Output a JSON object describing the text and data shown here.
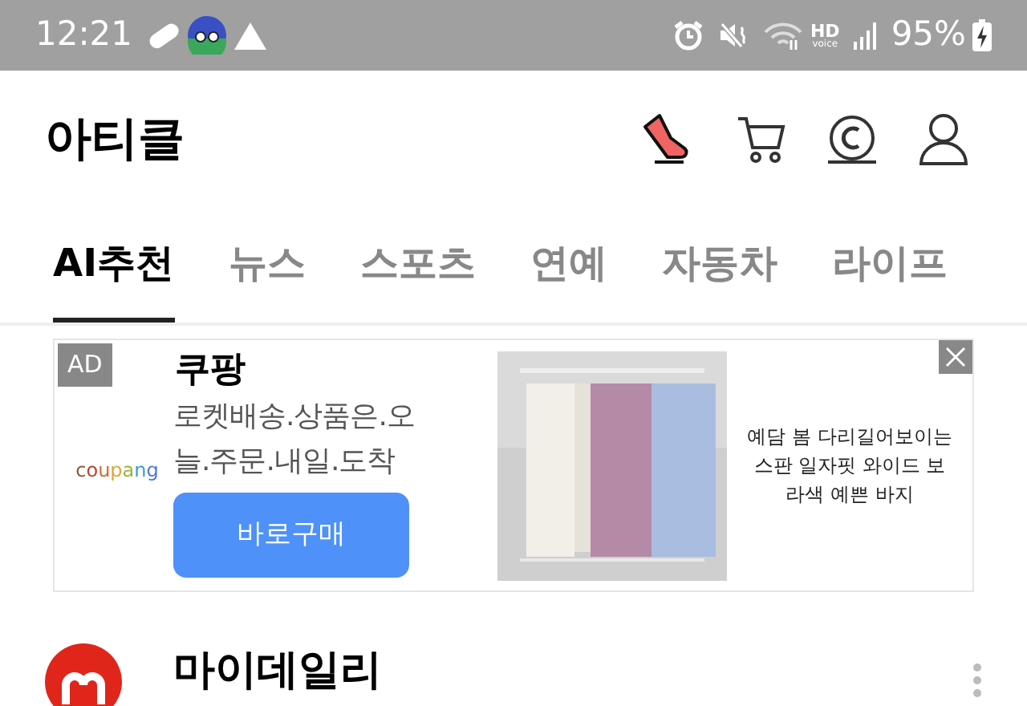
{
  "status_bar": {
    "time": "12:21",
    "hd": "HD",
    "voice": "voice",
    "battery": "95%"
  },
  "header": {
    "title": "아티클"
  },
  "tabs": [
    {
      "label": "AI추천",
      "selected": true
    },
    {
      "label": "뉴스",
      "selected": false
    },
    {
      "label": "스포츠",
      "selected": false
    },
    {
      "label": "연예",
      "selected": false
    },
    {
      "label": "자동차",
      "selected": false
    },
    {
      "label": "라이프",
      "selected": false
    }
  ],
  "ad": {
    "badge": "AD",
    "logo": "coupang",
    "title": "쿠팡",
    "description": "로켓배송.상품은.오늘.주문.내일.도착",
    "button": "바로구매",
    "caption": "예담 봄 다리길어보이는 스판 일자핏 와이드 보라색 예쁜 바지"
  },
  "article": {
    "source": "마이데일리"
  }
}
